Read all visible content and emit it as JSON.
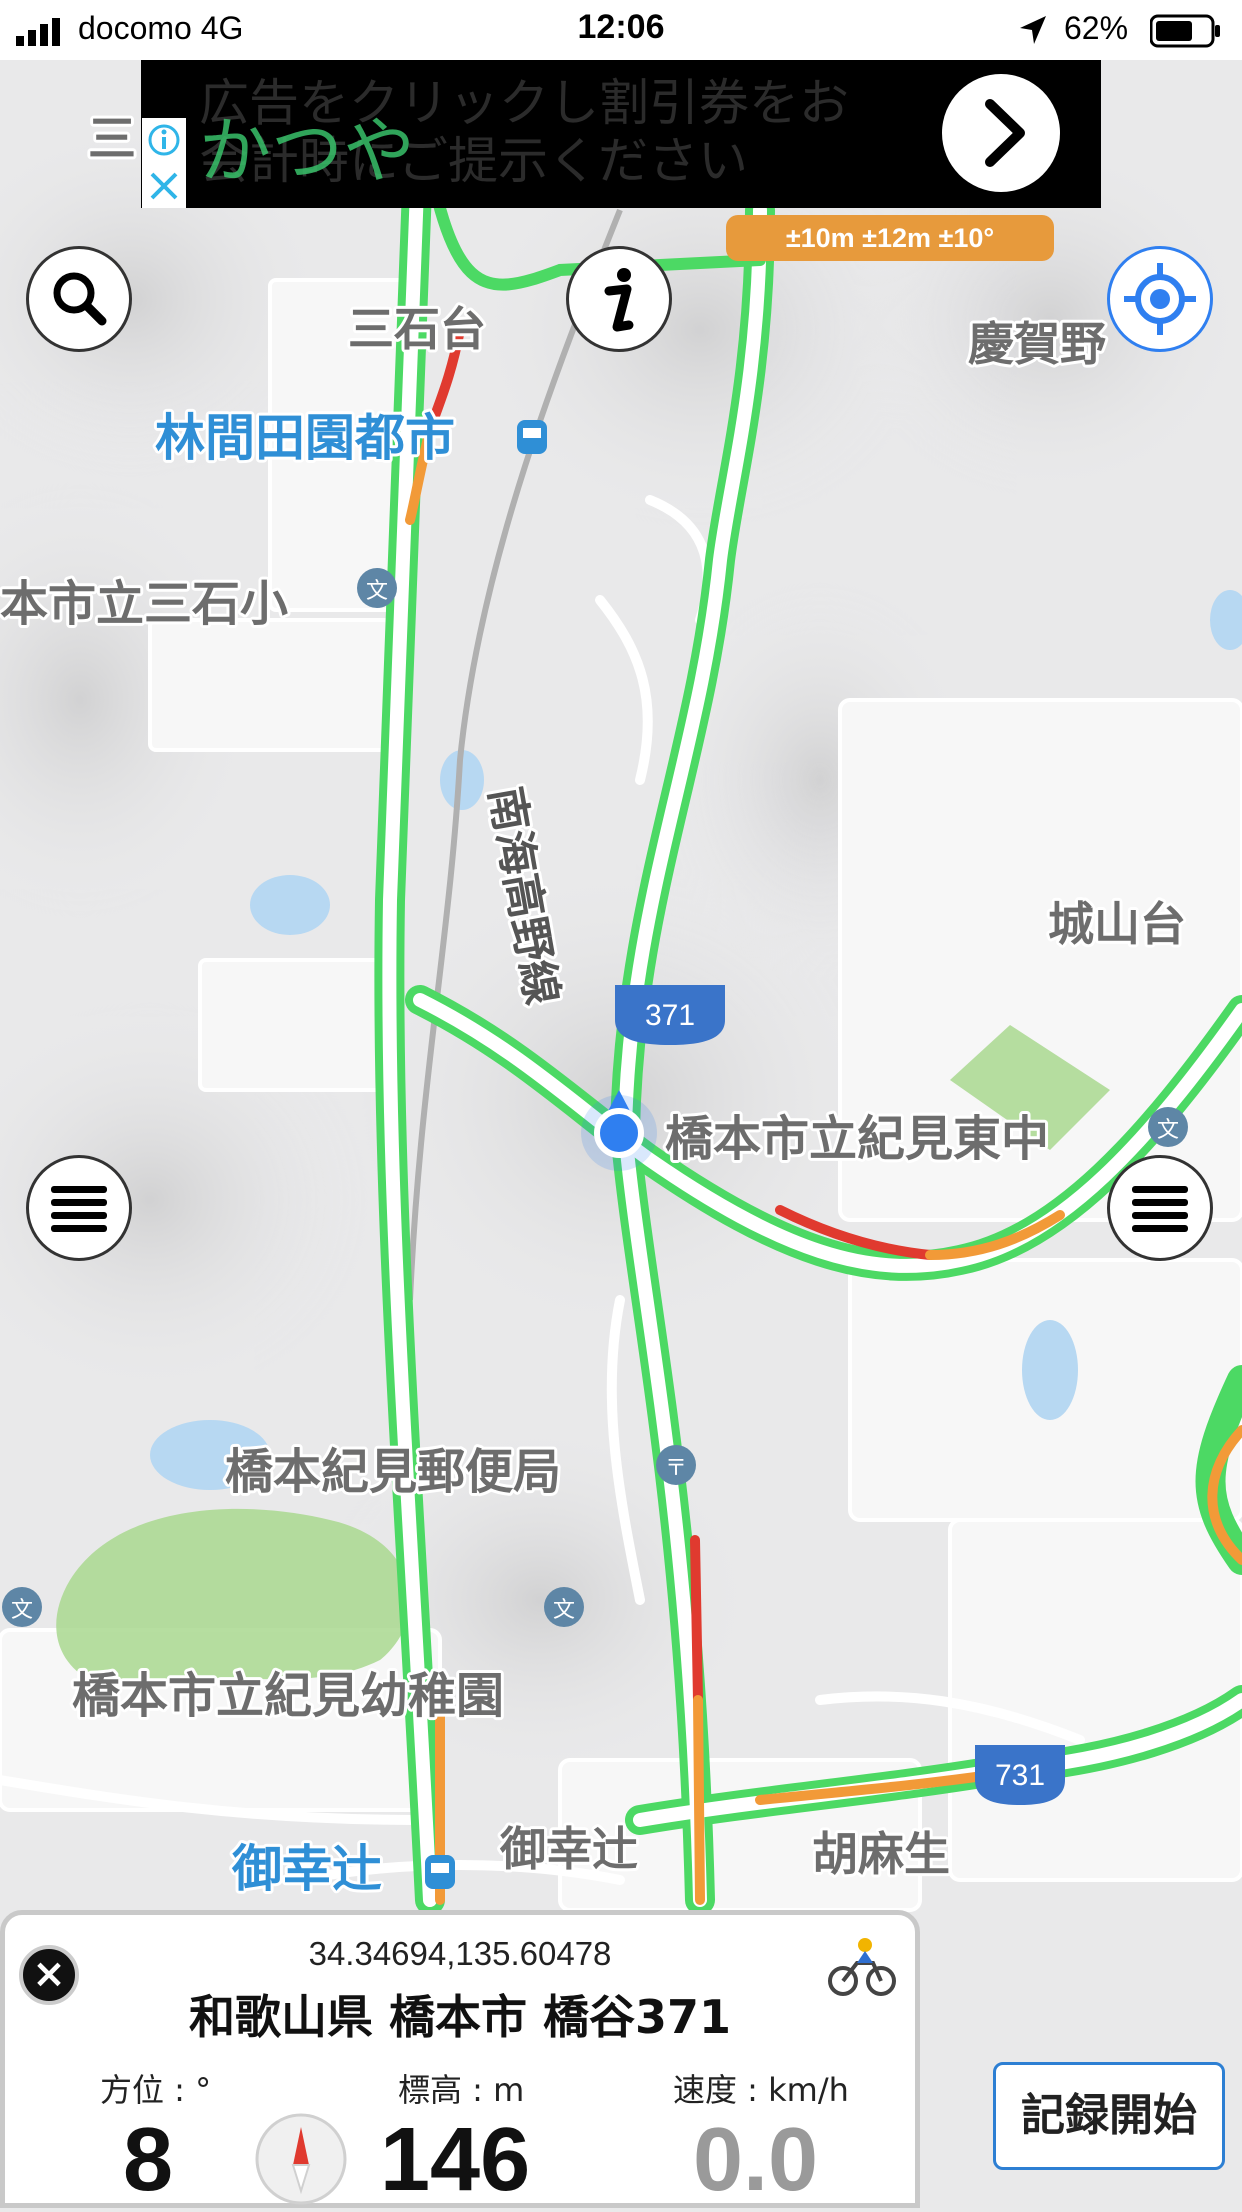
{
  "status_bar": {
    "carrier": "docomo  4G",
    "time": "12:06",
    "battery": "62%"
  },
  "ad": {
    "text_line1": "広告をクリックし割引券をお",
    "text_line2": "会計時にご提示ください",
    "brand": "かつや",
    "info_icon": "info-icon",
    "close_icon": "close-icon"
  },
  "accuracy": "±10m ±12m ±10°",
  "map": {
    "labels": {
      "mitsuishidai": "三石台",
      "keigano": "慶賀野",
      "rinkan": "林間田園都市",
      "school_mitsuishi": "本市立三石小",
      "nankai": "南海高野線",
      "shiroyamadai": "城山台",
      "school_kimi_east": "橋本市立紀見東中",
      "post_office": "橋本紀見郵便局",
      "kindergarten": "橋本市立紀見幼稚園",
      "miyukitsuji_station": "御幸辻",
      "miyukitsuji": "御幸辻",
      "gomasyo": "胡麻生",
      "partial_left": "三"
    },
    "route_shields": [
      "371",
      "731"
    ],
    "colors": {
      "road_green": "#4cd964",
      "road_orange": "#f29a38",
      "road_red": "#e03a2f",
      "water": "#b7d8f2",
      "park": "#a9d88f",
      "label_blue": "#2f8fd6",
      "shield_blue": "#3a74c9",
      "location_blue": "#2f7ff0"
    }
  },
  "info_panel": {
    "coords": "34.34694,135.60478",
    "address": "和歌山県 橋本市 橋谷371",
    "heading_label": "方位 : °",
    "heading_value": "8",
    "elevation_label": "標高 : m",
    "elevation_value": "146",
    "speed_label": "速度 : km/h",
    "speed_value": "0.0",
    "close_label": "×"
  },
  "record_button": "記録開始"
}
